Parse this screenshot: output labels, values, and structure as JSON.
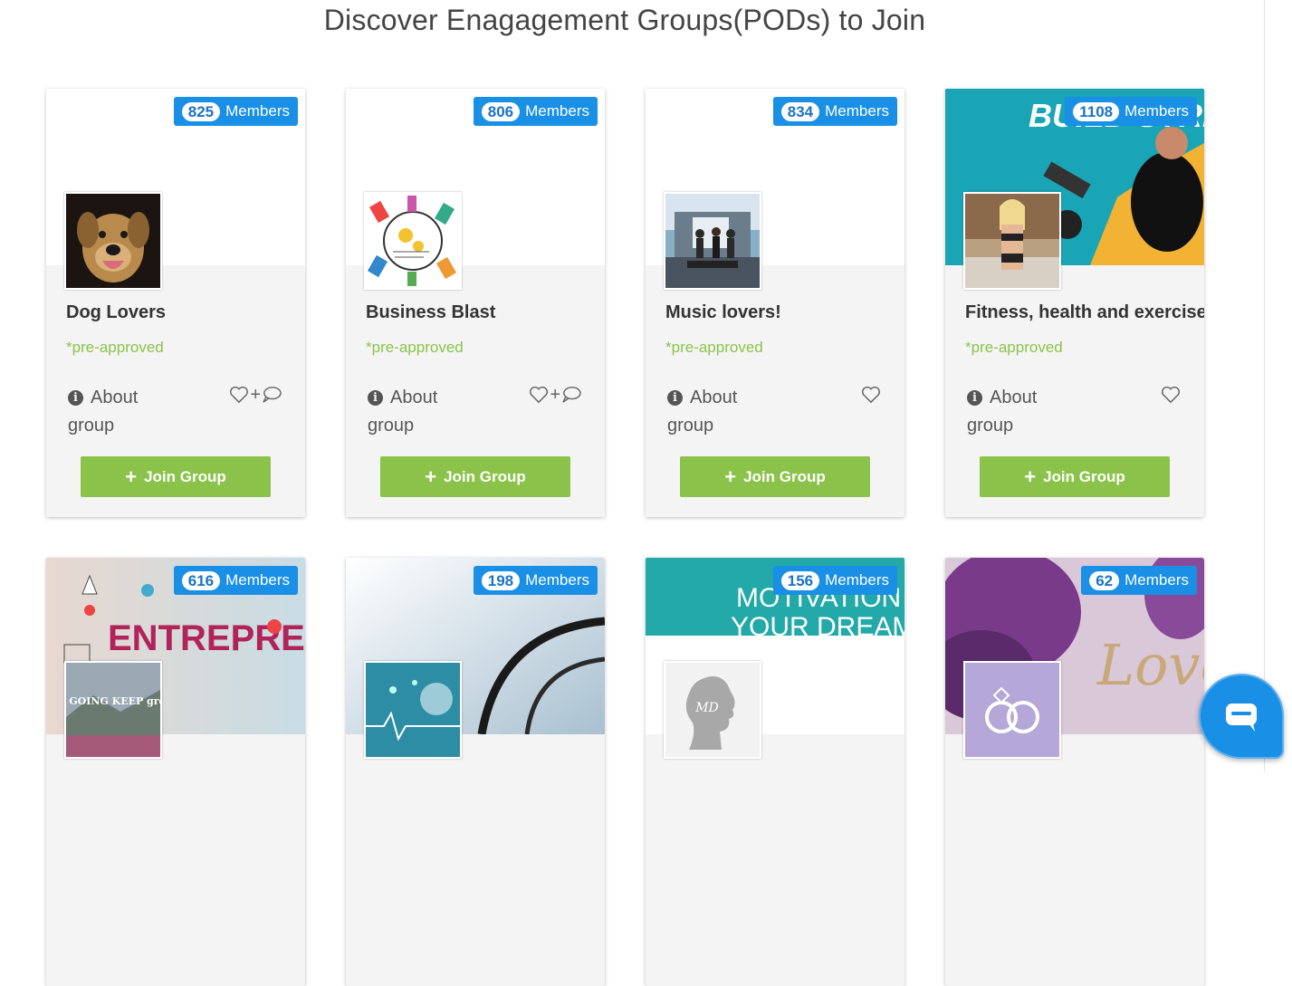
{
  "page": {
    "title": "Discover Enagagement Groups(PODs) to Join",
    "members_label": "Members",
    "preapproved_label": "*pre-approved",
    "about_label": "About group",
    "join_label": "Join Group"
  },
  "groups": [
    {
      "members": "825",
      "name": "Dog Lovers",
      "icons": [
        "heart-icon",
        "plus",
        "comment-icon"
      ]
    },
    {
      "members": "806",
      "name": "Business Blast",
      "icons": [
        "heart-icon",
        "plus",
        "comment-icon"
      ]
    },
    {
      "members": "834",
      "name": "Music lovers!",
      "icons": [
        "heart-icon"
      ]
    },
    {
      "members": "1108",
      "name": "Fitness, health and exercise",
      "cover_text": "BUILD STRENGTH",
      "icons": [
        "heart-icon"
      ]
    },
    {
      "members": "616",
      "name": "",
      "cover_text": "ENTREPRENEUR",
      "thumb_text": "KEEP GOING KEEP growing"
    },
    {
      "members": "198",
      "name": ""
    },
    {
      "members": "156",
      "name": "",
      "cover_text_1": "MOTIVATION",
      "cover_text_2": "YOUR DREAM",
      "thumb_text": "MD"
    },
    {
      "members": "62",
      "name": "",
      "cover_text": "Love"
    }
  ],
  "colors": {
    "badge": "#1a8fe6",
    "join_button": "#8bc34a",
    "preapproved": "#8bc34a",
    "card_bg": "#f4f4f4"
  },
  "chat_widget": {
    "icon": "chat-icon"
  }
}
